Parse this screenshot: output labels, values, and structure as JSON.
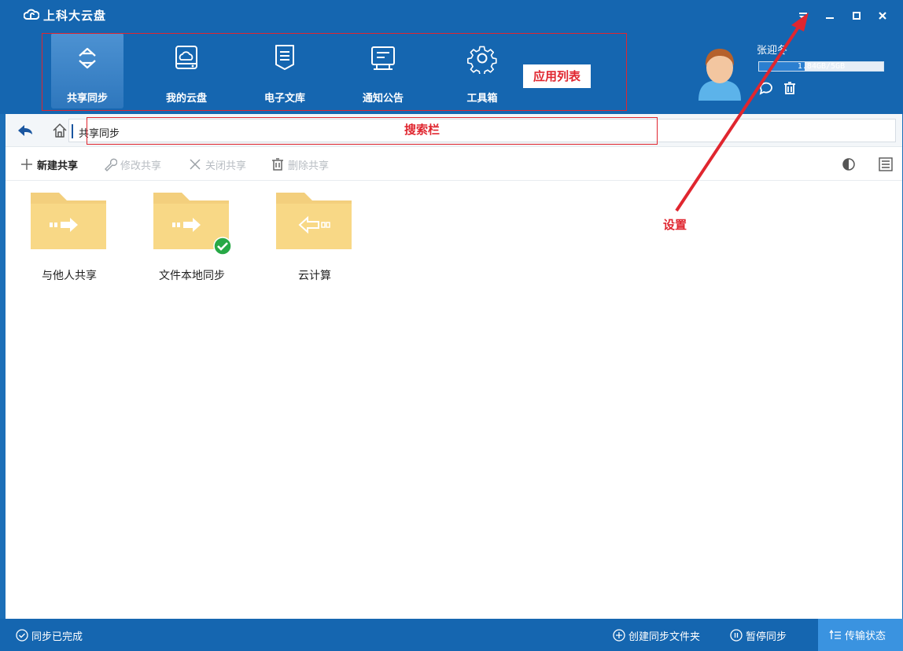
{
  "window": {
    "title": "上科大云盘"
  },
  "app_list": {
    "items": [
      {
        "label": "共享同步",
        "icon": "sync-icon",
        "active": true
      },
      {
        "label": "我的云盘",
        "icon": "cloud-drive-icon",
        "active": false
      },
      {
        "label": "电子文库",
        "icon": "library-icon",
        "active": false
      },
      {
        "label": "通知公告",
        "icon": "notice-board-icon",
        "active": false
      },
      {
        "label": "工具箱",
        "icon": "gear-icon",
        "active": false
      }
    ]
  },
  "user": {
    "name": "张迎冬",
    "quota_text": "1.84GB/5GB",
    "quota_used_fraction": 0.368
  },
  "address": {
    "path": "共享同步"
  },
  "toolbar": {
    "new_share": "新建共享",
    "modify_share": "修改共享",
    "close_share": "关闭共享",
    "delete_share": "删除共享"
  },
  "folders": [
    {
      "name": "与他人共享",
      "icon": "share-out-folder-icon",
      "synced": false
    },
    {
      "name": "文件本地同步",
      "icon": "share-out-folder-icon",
      "synced": true
    },
    {
      "name": "云计算",
      "icon": "share-in-folder-icon",
      "synced": false
    }
  ],
  "annotations": {
    "app_list": "应用列表",
    "search_bar": "搜索栏",
    "settings": "设置"
  },
  "statusbar": {
    "sync_status": "同步已完成",
    "create_sync_folder": "创建同步文件夹",
    "pause_sync": "暂停同步",
    "transfer_status": "传输状态"
  },
  "colors": {
    "primary": "#1566b0",
    "annotation_red": "#e0262f",
    "folder_yellow": "#f6d07a",
    "sync_ok_green": "#27a846"
  }
}
